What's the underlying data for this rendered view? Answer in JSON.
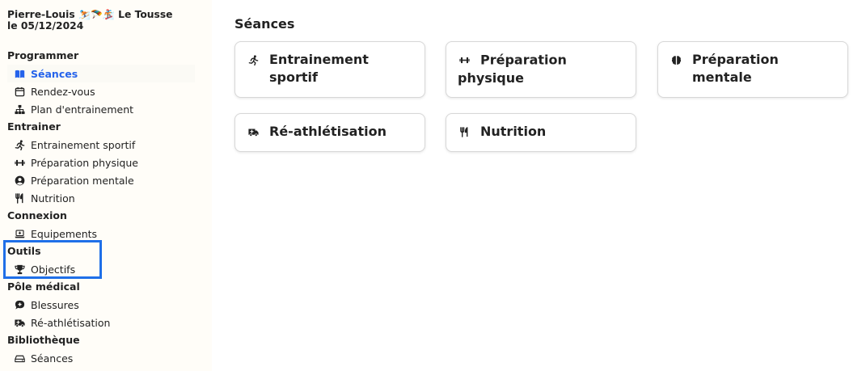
{
  "user": {
    "name": "Pierre-Louis",
    "emojis": "⛷️🪂🏂",
    "club": "Le Tousse",
    "date": "le 05/12/2024"
  },
  "sidebar": {
    "sections": [
      {
        "title": "Programmer",
        "items": [
          {
            "label": "Séances",
            "icon": "book-open-icon",
            "active": true
          },
          {
            "label": "Rendez-vous",
            "icon": "calendar-icon"
          },
          {
            "label": "Plan d'entrainement",
            "icon": "sitemap-icon"
          }
        ]
      },
      {
        "title": "Entrainer",
        "items": [
          {
            "label": "Entrainement sportif",
            "icon": "running-icon"
          },
          {
            "label": "Préparation physique",
            "icon": "dumbbell-icon"
          },
          {
            "label": "Préparation mentale",
            "icon": "user-circle-icon"
          },
          {
            "label": "Nutrition",
            "icon": "utensils-icon"
          }
        ]
      },
      {
        "title": "Connexion",
        "items": [
          {
            "label": "Equipements",
            "icon": "laptop-icon"
          }
        ]
      },
      {
        "title": "Outils",
        "items": [
          {
            "label": "Objectifs",
            "icon": "trophy-icon"
          }
        ]
      },
      {
        "title": "Pôle médical",
        "items": [
          {
            "label": "Blessures",
            "icon": "comment-medical-icon"
          },
          {
            "label": "Ré-athlétisation",
            "icon": "truck-medical-icon"
          }
        ]
      },
      {
        "title": "Bibliothèque",
        "items": [
          {
            "label": "Séances",
            "icon": "hdd-icon"
          }
        ]
      }
    ]
  },
  "main": {
    "title": "Séances",
    "cards": [
      {
        "label": "Entrainement sportif",
        "icon": "running-icon"
      },
      {
        "label": "Préparation physique",
        "icon": "dumbbell-icon"
      },
      {
        "label": "Préparation mentale",
        "icon": "brain-icon"
      },
      {
        "label": "Ré-athlétisation",
        "icon": "truck-medical-icon"
      },
      {
        "label": "Nutrition",
        "icon": "utensils-icon"
      }
    ]
  },
  "colors": {
    "accent": "#2563eb",
    "highlight": "#1f6fe8",
    "sidebar_bg": "#fffdf8"
  }
}
